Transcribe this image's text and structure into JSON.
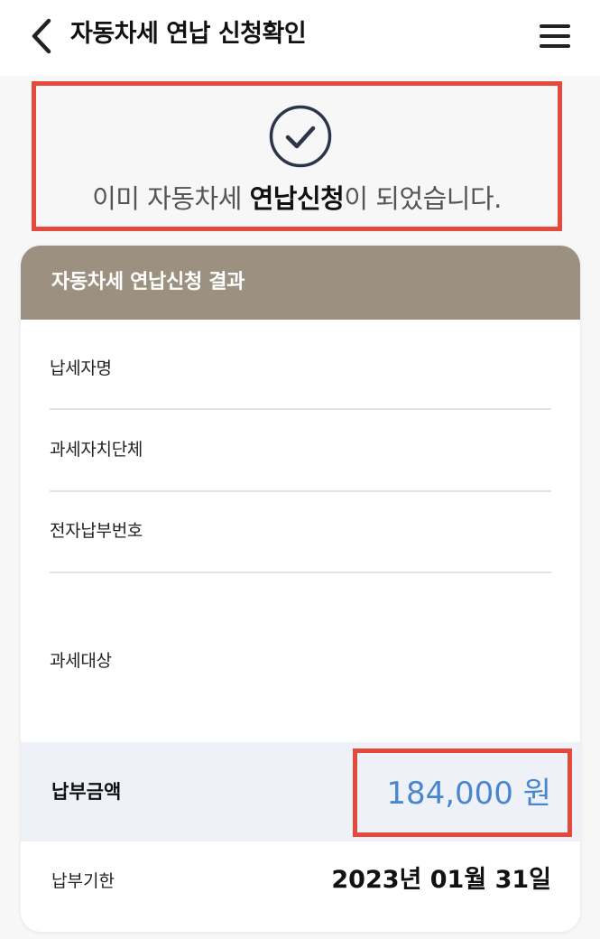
{
  "header": {
    "title": "자동차세 연납 신청확인",
    "back_icon": "chevron-left-icon",
    "menu_icon": "hamburger-menu-icon"
  },
  "notice": {
    "prefix": "이미 자동차세 ",
    "emphasis": "연납신청",
    "suffix": "이 되었습니다.",
    "icon": "check-circle-icon",
    "highlight_color": "#e5493b"
  },
  "result": {
    "title": "자동차세 연납신청 결과",
    "header_color": "#9c9180",
    "fields": [
      {
        "label": "납세자명"
      },
      {
        "label": "과세자치단체"
      },
      {
        "label": "전자납부번호"
      },
      {
        "label": "과세대상"
      }
    ],
    "amount": {
      "label": "납부금액",
      "value": "184,000 원",
      "value_color": "#4a86cf"
    },
    "due": {
      "label": "납부기한",
      "value": "2023년 01월 31일"
    }
  }
}
